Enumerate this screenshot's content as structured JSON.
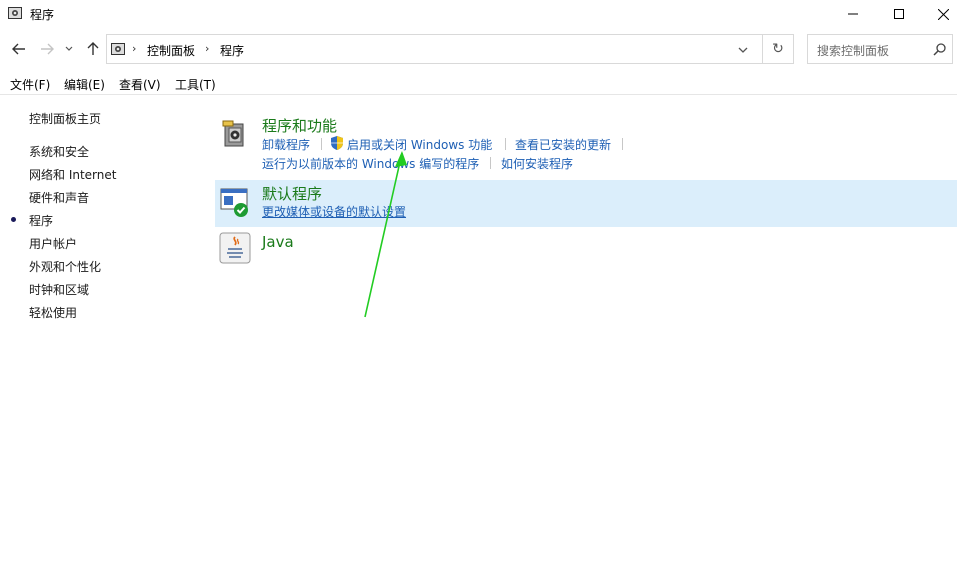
{
  "window": {
    "title": "程序",
    "controls": {
      "minimize_icon": "minimize-icon",
      "maximize_icon": "maximize-icon",
      "close_icon": "close-icon"
    }
  },
  "nav": {
    "back_icon": "back-arrow-icon",
    "forward_icon": "forward-arrow-icon",
    "recent_icon": "chevron-down-icon",
    "up_icon": "up-arrow-icon"
  },
  "address": {
    "breadcrumb": [
      "控制面板",
      "程序"
    ],
    "refresh_icon": "refresh-icon"
  },
  "search": {
    "placeholder": "搜索控制面板"
  },
  "menubar": [
    "文件(F)",
    "编辑(E)",
    "查看(V)",
    "工具(T)"
  ],
  "sidebar": {
    "home": "控制面板主页",
    "items": [
      "系统和安全",
      "网络和 Internet",
      "硬件和声音",
      "程序",
      "用户帐户",
      "外观和个性化",
      "时钟和区域",
      "轻松使用"
    ],
    "active": "程序"
  },
  "categories": [
    {
      "title": "程序和功能",
      "links": [
        "卸载程序",
        "启用或关闭 Windows 功能",
        "查看已安装的更新",
        "运行为以前版本的 Windows 编写的程序",
        "如何安装程序"
      ]
    },
    {
      "title": "默认程序",
      "links": [
        "更改媒体或设备的默认设置"
      ]
    },
    {
      "title": "Java",
      "links": []
    }
  ],
  "colors": {
    "category_title": "#1a7a1a",
    "link": "#1e5fb4",
    "selected_bg": "#dbeefb",
    "annotation_arrow": "#22cc22"
  }
}
